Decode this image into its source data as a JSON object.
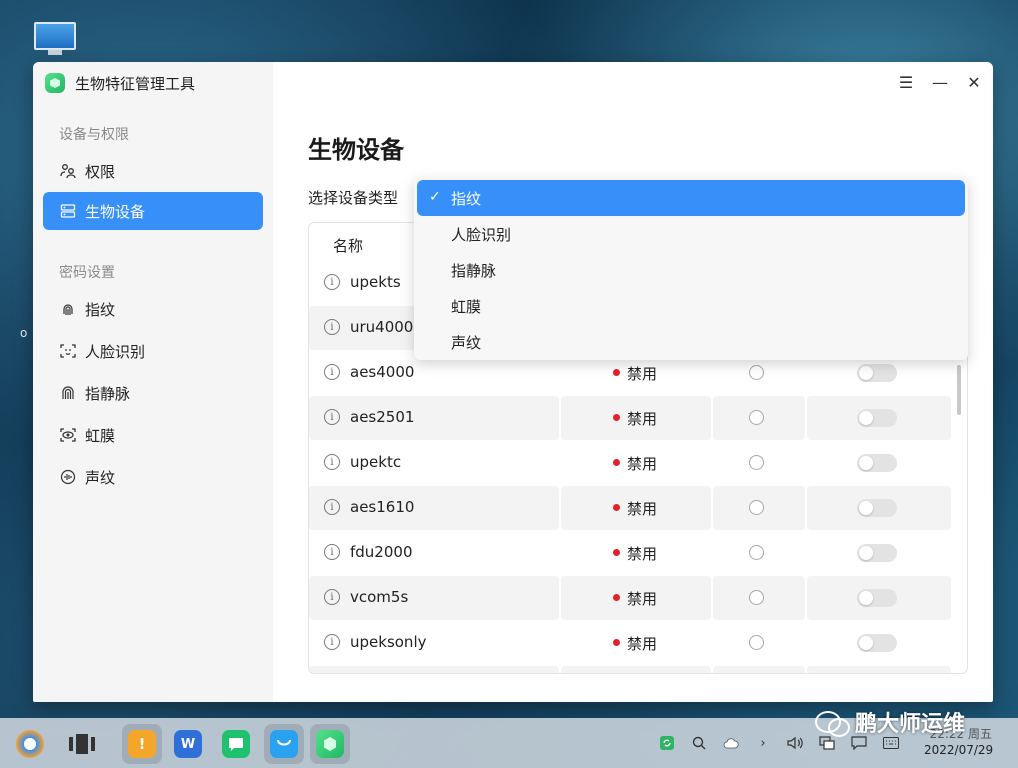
{
  "window": {
    "title": "生物特征管理工具",
    "controls": {
      "menu": "☰",
      "minimize": "—",
      "close": "✕"
    }
  },
  "sidebar": {
    "sections": [
      {
        "label": "设备与权限",
        "items": [
          {
            "label": "权限",
            "icon": "permission-icon"
          },
          {
            "label": "生物设备",
            "icon": "device-icon",
            "active": true
          }
        ]
      },
      {
        "label": "密码设置",
        "items": [
          {
            "label": "指纹",
            "icon": "fingerprint-icon"
          },
          {
            "label": "人脸识别",
            "icon": "face-icon"
          },
          {
            "label": "指静脉",
            "icon": "finger-vein-icon"
          },
          {
            "label": "虹膜",
            "icon": "iris-icon"
          },
          {
            "label": "声纹",
            "icon": "voiceprint-icon"
          }
        ]
      }
    ]
  },
  "main": {
    "title": "生物设备",
    "select_label": "选择设备类型",
    "dropdown": {
      "options": [
        "指纹",
        "人脸识别",
        "指静脉",
        "虹膜",
        "声纹"
      ],
      "selected": "指纹"
    },
    "table": {
      "column_name": "名称",
      "rows": [
        {
          "name": "upekts",
          "status": ""
        },
        {
          "name": "uru4000",
          "status": ""
        },
        {
          "name": "aes4000",
          "status": "禁用"
        },
        {
          "name": "aes2501",
          "status": "禁用"
        },
        {
          "name": "upektc",
          "status": "禁用"
        },
        {
          "name": "aes1610",
          "status": "禁用"
        },
        {
          "name": "fdu2000",
          "status": "禁用"
        },
        {
          "name": "vcom5s",
          "status": "禁用"
        },
        {
          "name": "upeksonly",
          "status": "禁用"
        }
      ],
      "status_color": "#e0222a"
    }
  },
  "taskbar": {
    "date": "2022/07/29",
    "time": "22:22 周五",
    "watermark": "鹏大师运维"
  },
  "colors": {
    "accent": "#3790fa",
    "sidebar_bg": "#f5f5f5"
  }
}
